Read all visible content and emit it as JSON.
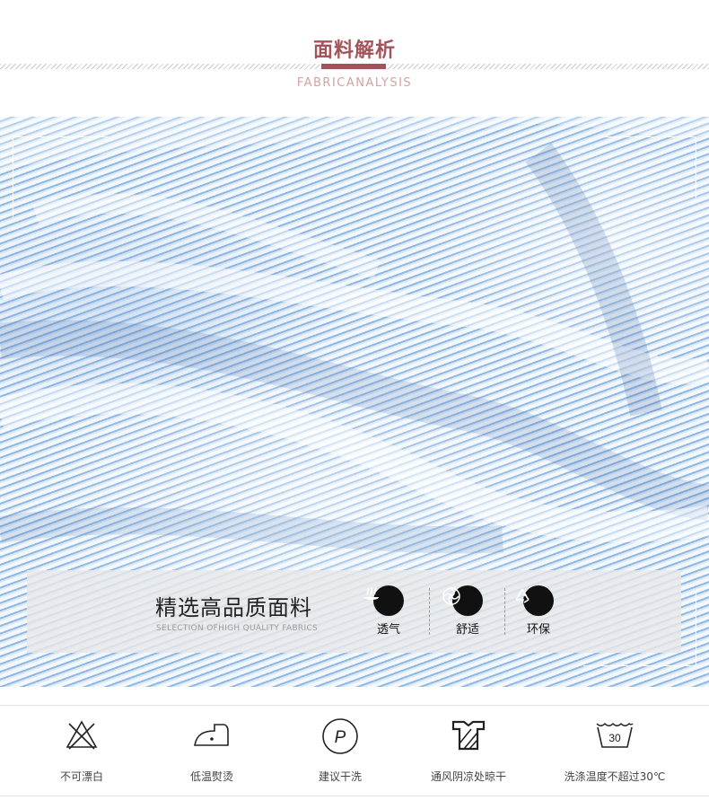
{
  "header": {
    "title": "面料解析",
    "subtitle": "FABRICANALYSIS"
  },
  "colors": {
    "accent": "#a2545a",
    "subtitle": "#d1a2a2",
    "fabric_blue": "#8fb8e2"
  },
  "quality": {
    "title": "精选高品质面料",
    "subtitle": "SELECTION OFHIGH QUALITY FABRICS",
    "features": [
      {
        "label": "透气",
        "icon": "breathable-icon"
      },
      {
        "label": "舒适",
        "icon": "comfort-icon"
      },
      {
        "label": "环保",
        "icon": "recycle-icon"
      }
    ]
  },
  "care": [
    {
      "label": "不可漂白",
      "icon": "no-bleach-icon"
    },
    {
      "label": "低温熨烫",
      "icon": "low-iron-icon"
    },
    {
      "label": "建议干洗",
      "icon": "dry-clean-icon",
      "symbol": "P"
    },
    {
      "label": "通风阴凉处晾干",
      "icon": "shade-dry-icon"
    },
    {
      "label": "洗涤温度不超过30℃",
      "icon": "wash-30-icon",
      "symbol": "30"
    }
  ]
}
